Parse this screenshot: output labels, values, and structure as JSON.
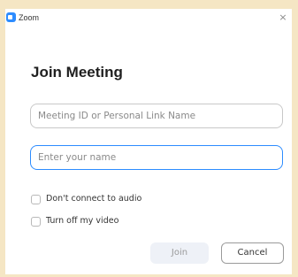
{
  "window": {
    "title": "Zoom",
    "close_symbol": "×",
    "icon": "zoom-logo-icon"
  },
  "dialog": {
    "heading": "Join Meeting",
    "meeting_id": {
      "value": "",
      "placeholder": "Meeting ID or Personal Link Name"
    },
    "name": {
      "value": "",
      "placeholder": "Enter your name"
    },
    "options": [
      {
        "label": "Don't connect to audio",
        "checked": false
      },
      {
        "label": "Turn off my video",
        "checked": false
      }
    ],
    "buttons": {
      "join_label": "Join",
      "cancel_label": "Cancel"
    }
  },
  "colors": {
    "accent": "#2d8cff",
    "background_frame": "#f5e6c4"
  }
}
